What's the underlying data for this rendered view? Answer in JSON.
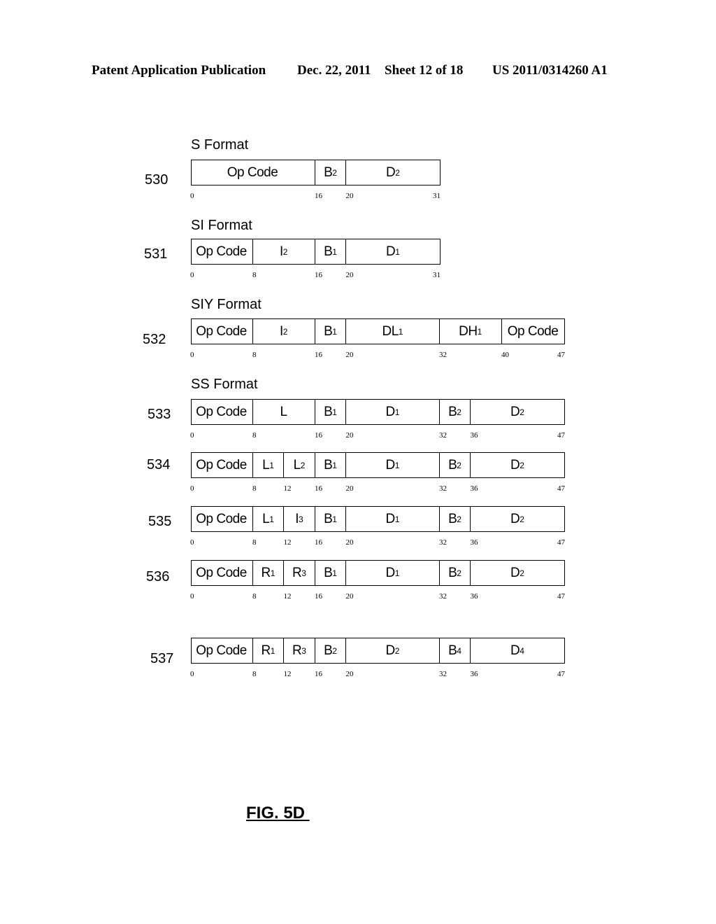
{
  "header": {
    "left": "Patent Application Publication",
    "date": "Dec. 22, 2011",
    "sheet": "Sheet 12 of 18",
    "number": "US 2011/0314260 A1"
  },
  "figure_label": "FIG. 5D",
  "formats": [
    {
      "ref": "530",
      "title": "S Format",
      "total_bits": 31,
      "fields": [
        {
          "name": "Op Code",
          "sub": "",
          "start": 0,
          "end": 16
        },
        {
          "name": "B",
          "sub": "2",
          "start": 16,
          "end": 20
        },
        {
          "name": "D",
          "sub": "2",
          "start": 20,
          "end": 32
        }
      ],
      "ticks": [
        "0",
        "16",
        "20",
        "31"
      ]
    },
    {
      "ref": "531",
      "title": "SI Format",
      "total_bits": 31,
      "fields": [
        {
          "name": "Op Code",
          "sub": "",
          "start": 0,
          "end": 8
        },
        {
          "name": "I",
          "sub": "2",
          "start": 8,
          "end": 16
        },
        {
          "name": "B",
          "sub": "1",
          "start": 16,
          "end": 20
        },
        {
          "name": "D",
          "sub": "1",
          "start": 20,
          "end": 32
        }
      ],
      "ticks": [
        "0",
        "8",
        "16",
        "20",
        "31"
      ]
    },
    {
      "ref": "532",
      "title": "SIY Format",
      "total_bits": 47,
      "fields": [
        {
          "name": "Op Code",
          "sub": "",
          "start": 0,
          "end": 8
        },
        {
          "name": "I",
          "sub": "2",
          "start": 8,
          "end": 16
        },
        {
          "name": "B",
          "sub": "1",
          "start": 16,
          "end": 20
        },
        {
          "name": "DL",
          "sub": "1",
          "start": 20,
          "end": 32
        },
        {
          "name": "DH",
          "sub": "1",
          "start": 32,
          "end": 40
        },
        {
          "name": "Op Code",
          "sub": "",
          "start": 40,
          "end": 48
        }
      ],
      "ticks": [
        "0",
        "8",
        "16",
        "20",
        "32",
        "40",
        "47"
      ]
    },
    {
      "ref": "533",
      "title": "SS Format",
      "total_bits": 47,
      "fields": [
        {
          "name": "Op Code",
          "sub": "",
          "start": 0,
          "end": 8
        },
        {
          "name": "L",
          "sub": "",
          "start": 8,
          "end": 16
        },
        {
          "name": "B",
          "sub": "1",
          "start": 16,
          "end": 20
        },
        {
          "name": "D",
          "sub": "1",
          "start": 20,
          "end": 32
        },
        {
          "name": "B",
          "sub": "2",
          "start": 32,
          "end": 36
        },
        {
          "name": "D",
          "sub": "2",
          "start": 36,
          "end": 48
        }
      ],
      "ticks": [
        "0",
        "8",
        "16",
        "20",
        "32",
        "36",
        "47"
      ]
    },
    {
      "ref": "534",
      "title": "",
      "total_bits": 47,
      "fields": [
        {
          "name": "Op Code",
          "sub": "",
          "start": 0,
          "end": 8
        },
        {
          "name": "L",
          "sub": "1",
          "start": 8,
          "end": 12
        },
        {
          "name": "L",
          "sub": "2",
          "start": 12,
          "end": 16
        },
        {
          "name": "B",
          "sub": "1",
          "start": 16,
          "end": 20
        },
        {
          "name": "D",
          "sub": "1",
          "start": 20,
          "end": 32
        },
        {
          "name": "B",
          "sub": "2",
          "start": 32,
          "end": 36
        },
        {
          "name": "D",
          "sub": "2",
          "start": 36,
          "end": 48
        }
      ],
      "ticks": [
        "0",
        "8",
        "12",
        "16",
        "20",
        "32",
        "36",
        "47"
      ]
    },
    {
      "ref": "535",
      "title": "",
      "total_bits": 47,
      "fields": [
        {
          "name": "Op Code",
          "sub": "",
          "start": 0,
          "end": 8
        },
        {
          "name": "L",
          "sub": "1",
          "start": 8,
          "end": 12
        },
        {
          "name": "I",
          "sub": "3",
          "start": 12,
          "end": 16
        },
        {
          "name": "B",
          "sub": "1",
          "start": 16,
          "end": 20
        },
        {
          "name": "D",
          "sub": "1",
          "start": 20,
          "end": 32
        },
        {
          "name": "B",
          "sub": "2",
          "start": 32,
          "end": 36
        },
        {
          "name": "D",
          "sub": "2",
          "start": 36,
          "end": 48
        }
      ],
      "ticks": [
        "0",
        "8",
        "12",
        "16",
        "20",
        "32",
        "36",
        "47"
      ]
    },
    {
      "ref": "536",
      "title": "",
      "total_bits": 47,
      "fields": [
        {
          "name": "Op Code",
          "sub": "",
          "start": 0,
          "end": 8
        },
        {
          "name": "R",
          "sub": "1",
          "start": 8,
          "end": 12
        },
        {
          "name": "R",
          "sub": "3",
          "start": 12,
          "end": 16
        },
        {
          "name": "B",
          "sub": "1",
          "start": 16,
          "end": 20
        },
        {
          "name": "D",
          "sub": "1",
          "start": 20,
          "end": 32
        },
        {
          "name": "B",
          "sub": "2",
          "start": 32,
          "end": 36
        },
        {
          "name": "D",
          "sub": "2",
          "start": 36,
          "end": 48
        }
      ],
      "ticks": [
        "0",
        "8",
        "12",
        "16",
        "20",
        "32",
        "36",
        "47"
      ]
    },
    {
      "ref": "537",
      "title": "",
      "total_bits": 47,
      "fields": [
        {
          "name": "Op Code",
          "sub": "",
          "start": 0,
          "end": 8
        },
        {
          "name": "R",
          "sub": "1",
          "start": 8,
          "end": 12
        },
        {
          "name": "R",
          "sub": "3",
          "start": 12,
          "end": 16
        },
        {
          "name": "B",
          "sub": "2",
          "start": 16,
          "end": 20
        },
        {
          "name": "D",
          "sub": "2",
          "start": 20,
          "end": 32
        },
        {
          "name": "B",
          "sub": "4",
          "start": 32,
          "end": 36
        },
        {
          "name": "D",
          "sub": "4",
          "start": 36,
          "end": 48
        }
      ],
      "ticks": [
        "0",
        "8",
        "12",
        "16",
        "20",
        "32",
        "36",
        "47"
      ]
    }
  ]
}
